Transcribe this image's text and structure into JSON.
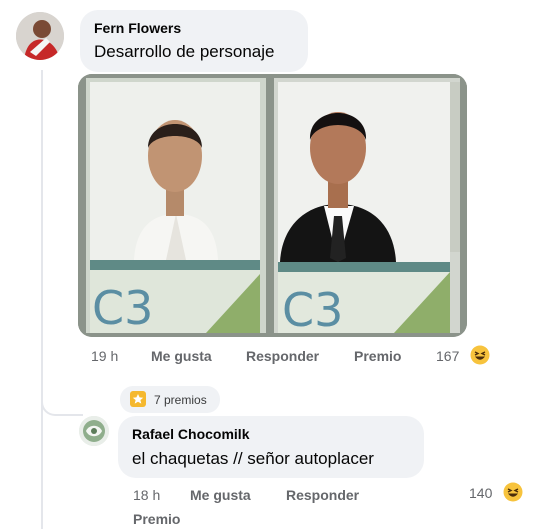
{
  "comment1": {
    "author": "Fern Flowers",
    "text": "Desarrollo de personaje",
    "time": "19 h",
    "like_label": "Me gusta",
    "reply_label": "Responder",
    "award_label": "Premio",
    "reaction_count": "167",
    "reaction_icon": "haha-emoji-icon"
  },
  "award": {
    "label": "7 premios",
    "icon": "award-badge-icon",
    "color": "#f5b82e"
  },
  "comment2": {
    "author": "Rafael Chocomilk",
    "text": "el chaquetas // señor autoplacer",
    "time": "18 h",
    "like_label": "Me gusta",
    "reply_label": "Responder",
    "award_label": "Premio",
    "reaction_count": "140",
    "reaction_icon": "haha-emoji-icon"
  },
  "colors": {
    "bubble": "#f0f2f5",
    "meta_text": "#65676b",
    "reaction_yellow": "#f7c33d"
  }
}
